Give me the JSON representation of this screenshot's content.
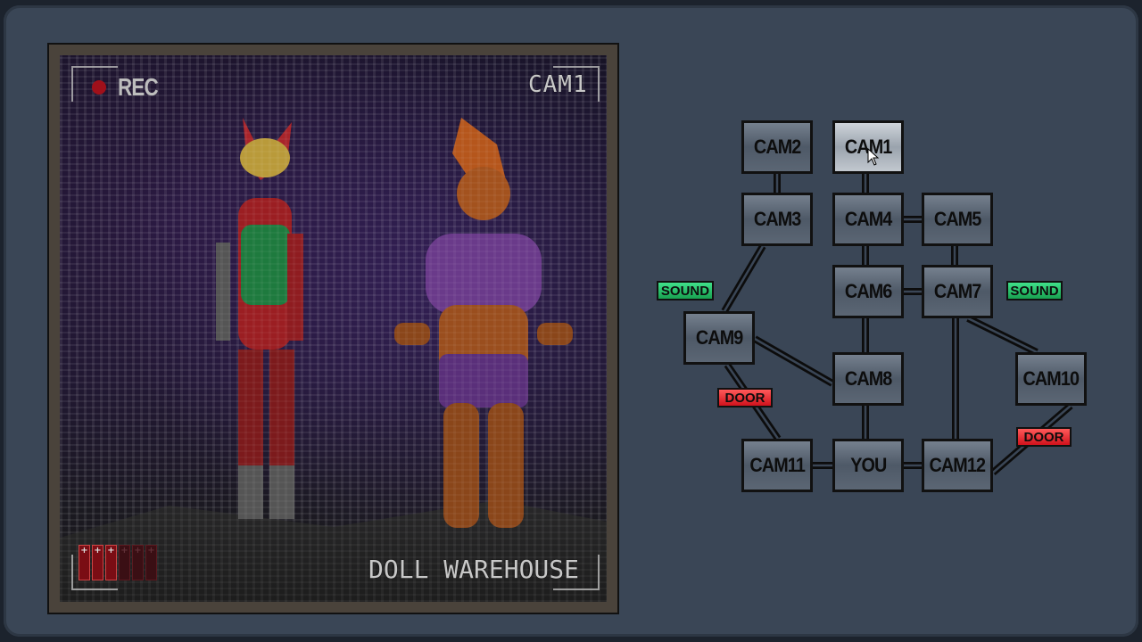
{
  "feed": {
    "rec_label": "REC",
    "camera_label": "CAM1",
    "location": "DOLL WAREHOUSE",
    "battery": {
      "cells_total": 6,
      "cells_charged": 3,
      "cell_symbol": "+"
    },
    "rec_color": "#a0101a"
  },
  "map": {
    "active_camera": "CAM1",
    "cameras": [
      {
        "id": "cam2",
        "label": "CAM2"
      },
      {
        "id": "cam1",
        "label": "CAM1"
      },
      {
        "id": "cam3",
        "label": "CAM3"
      },
      {
        "id": "cam4",
        "label": "CAM4"
      },
      {
        "id": "cam5",
        "label": "CAM5"
      },
      {
        "id": "cam6",
        "label": "CAM6"
      },
      {
        "id": "cam7",
        "label": "CAM7"
      },
      {
        "id": "cam9",
        "label": "CAM9"
      },
      {
        "id": "cam8",
        "label": "CAM8"
      },
      {
        "id": "cam10",
        "label": "CAM10"
      },
      {
        "id": "cam11",
        "label": "CAM11"
      },
      {
        "id": "you",
        "label": "YOU"
      },
      {
        "id": "cam12",
        "label": "CAM12"
      }
    ],
    "tags": {
      "sound_left": "SOUND",
      "sound_right": "SOUND",
      "door_left": "DOOR",
      "door_right": "DOOR"
    },
    "colors": {
      "sound": "#18a150",
      "door": "#d0121c",
      "panel": "#3a4656"
    }
  }
}
